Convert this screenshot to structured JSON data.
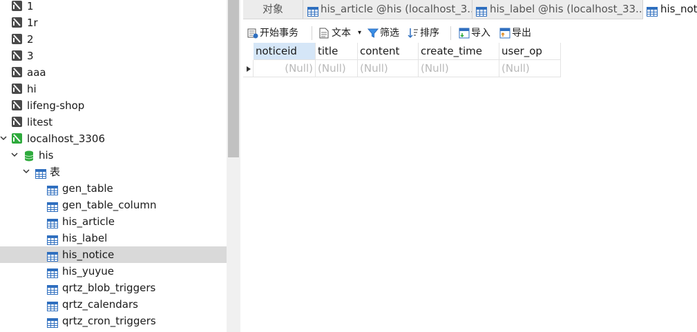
{
  "tree": {
    "connections": [
      "1",
      "1r",
      "2",
      "3",
      "aaa",
      "hi",
      "lifeng-shop",
      "litest"
    ],
    "open_connection": "localhost_3306",
    "database": "his",
    "tables_folder": "表",
    "tables": [
      "gen_table",
      "gen_table_column",
      "his_article",
      "his_label",
      "his_notice",
      "his_yuyue",
      "qrtz_blob_triggers",
      "qrtz_calendars",
      "qrtz_cron_triggers"
    ],
    "selected_table": "his_notice"
  },
  "tabs": {
    "objects": "对象",
    "tab1": "his_article @his (localhost_3...",
    "tab2": "his_label @his (localhost_33...",
    "tab3": "his_not"
  },
  "toolbar": {
    "begin_transaction": "开始事务",
    "text": "文本",
    "filter": "筛选",
    "sort": "排序",
    "import": "导入",
    "export": "导出"
  },
  "grid": {
    "columns": [
      "noticeid",
      "title",
      "content",
      "create_time",
      "user_op"
    ],
    "row": [
      "(Null)",
      "(Null)",
      "(Null)",
      "(Null)",
      "(Null)"
    ]
  },
  "colors": {
    "selected_row": "#d9d9d9",
    "header_highlight": "#d5e6f7",
    "null_text": "#b9b9b9",
    "connection_icon_gray": "#4a4a4a",
    "connection_icon_green": "#2eaa3c"
  }
}
